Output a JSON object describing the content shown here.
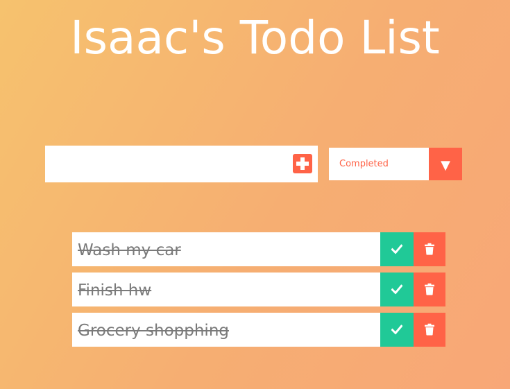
{
  "header": {
    "title": "Isaac's Todo List"
  },
  "form": {
    "input_value": "",
    "add_icon": "plus-icon",
    "filter_selected": "Completed",
    "filter_icon": "caret-down-icon",
    "filter_arrow_glyph": "▼"
  },
  "todos": [
    {
      "text": "Wash my car",
      "completed": true
    },
    {
      "text": "Finish hw",
      "completed": true
    },
    {
      "text": "Grocery shopphing",
      "completed": true
    }
  ],
  "colors": {
    "accent": "#ff6347",
    "complete": "#20c997",
    "background_start": "#f6c26e",
    "background_end": "#f8a777"
  }
}
